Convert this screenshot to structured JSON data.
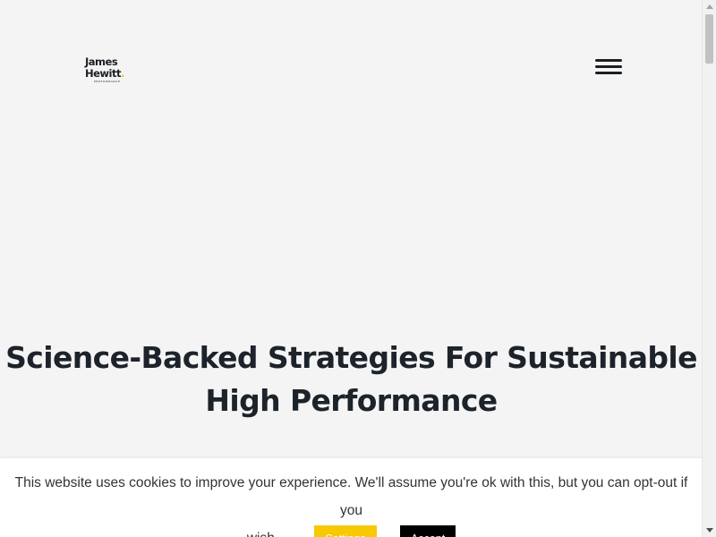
{
  "header": {
    "logo": {
      "line1": "James",
      "line2": "Hewitt",
      "dot": ".",
      "tagline": "PERFORMANCE"
    },
    "menu_icon": "hamburger-menu-icon"
  },
  "hero": {
    "title": "Science-Backed Strategies For Sustainable High Performance"
  },
  "cookie_bar": {
    "message": "This website uses cookies to improve your experience. We'll assume you're ok with this, but you can opt-out if you",
    "message_end": "wish.",
    "settings_label": "Settings",
    "accept_label": "Accept",
    "settings_color": "#f8c800",
    "accept_color": "#000000"
  },
  "colors": {
    "background": "#f4f4f4",
    "text": "#1d232a",
    "accent": "#f5c400"
  }
}
